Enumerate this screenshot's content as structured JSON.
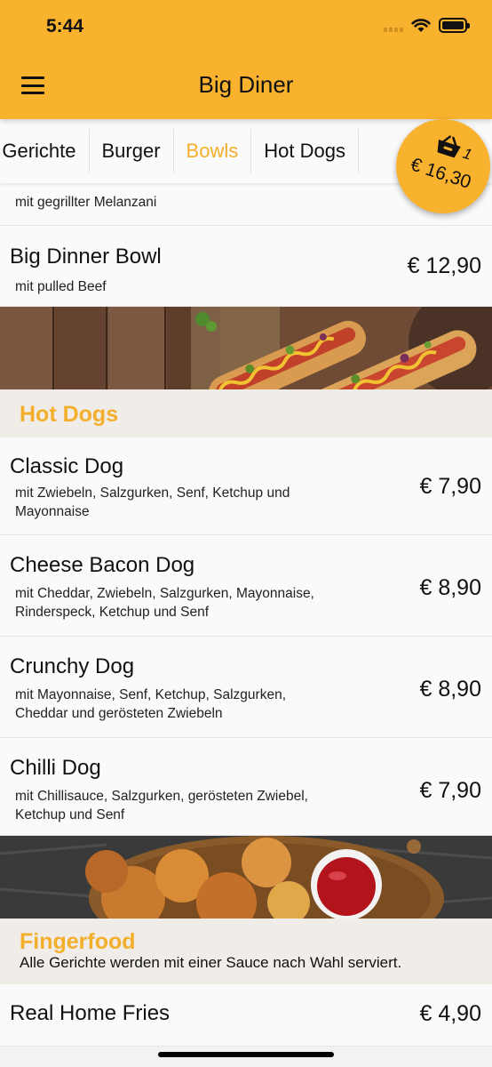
{
  "status_bar": {
    "time": "5:44"
  },
  "header": {
    "title": "Big Diner"
  },
  "tabs": [
    {
      "label": "e Gerichte"
    },
    {
      "label": "Burger"
    },
    {
      "label": "Bowls"
    },
    {
      "label": "Hot Dogs"
    }
  ],
  "active_tab": "Bowls",
  "cart": {
    "count": "1",
    "total": "€ 16,30"
  },
  "bowls_items": [
    {
      "title": "",
      "description": "mit gegrillter Melanzani",
      "price": ""
    },
    {
      "title": "Big Dinner Bowl",
      "description": "mit pulled Beef",
      "price": "€ 12,90"
    }
  ],
  "hot_dogs": {
    "title": "Hot Dogs",
    "items": [
      {
        "title": "Classic Dog",
        "description_line1": "mit Zwiebeln, Salzgurken, Senf, Ketchup und",
        "description_line2": "Mayonnaise",
        "price": "€ 7,90"
      },
      {
        "title": "Cheese Bacon Dog",
        "description_line1": "mit Cheddar, Zwiebeln, Salzgurken, Mayonnaise,",
        "description_line2": "Rinderspeck, Ketchup und Senf",
        "price": "€ 8,90"
      },
      {
        "title": "Crunchy Dog",
        "description_line1": "mit Mayonnaise, Senf, Ketchup, Salzgurken,",
        "description_line2": "Cheddar und gerösteten Zwiebeln",
        "price": "€ 8,90"
      },
      {
        "title": "Chilli Dog",
        "description_line1": "mit Chillisauce, Salzgurken, gerösteten Zwiebel,",
        "description_line2": "Ketchup und Senf",
        "price": "€ 7,90"
      }
    ]
  },
  "fingerfood": {
    "title": "Fingerfood",
    "note": "Alle Gerichte werden mit einer Sauce nach Wahl serviert.",
    "items": [
      {
        "title": "Real Home Fries",
        "price": "€ 4,90"
      }
    ]
  },
  "colors": {
    "accent": "#f8b22e",
    "accent_text": "#f3ae2c",
    "section_bg": "#f0ece7",
    "row_bg": "#fafafa"
  },
  "icons": {
    "menu": "hamburger-icon",
    "cart": "basket-icon",
    "wifi": "wifi-icon",
    "battery": "battery-icon"
  }
}
